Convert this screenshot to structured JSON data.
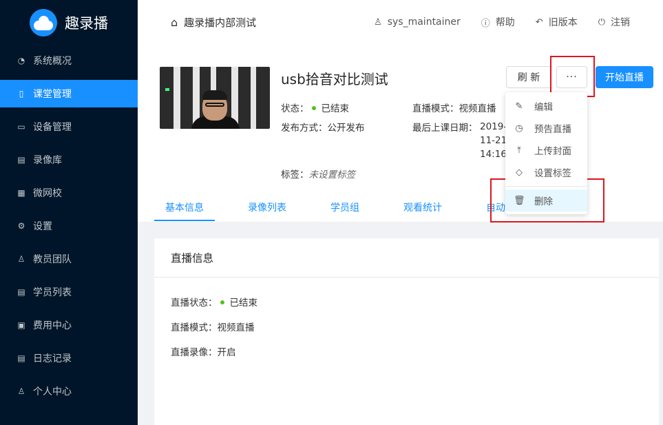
{
  "app": {
    "name": "趣录播"
  },
  "sidebar": {
    "items": [
      {
        "label": "系统概况",
        "icon": "dashboard-icon"
      },
      {
        "label": "课堂管理",
        "icon": "book-icon",
        "active": true
      },
      {
        "label": "设备管理",
        "icon": "camera-icon"
      },
      {
        "label": "录像库",
        "icon": "library-icon"
      },
      {
        "label": "微网校",
        "icon": "school-icon"
      },
      {
        "label": "设置",
        "icon": "gear-icon"
      },
      {
        "label": "教员团队",
        "icon": "team-icon"
      },
      {
        "label": "学员列表",
        "icon": "student-list-icon"
      },
      {
        "label": "费用中心",
        "icon": "billing-icon"
      },
      {
        "label": "日志记录",
        "icon": "log-icon"
      },
      {
        "label": "个人中心",
        "icon": "user-icon"
      }
    ]
  },
  "header": {
    "breadcrumb": "趣录播内部测试",
    "user": "sys_maintainer",
    "help": "帮助",
    "old_version": "旧版本",
    "logout": "注销"
  },
  "course": {
    "title": "usb拾音对比测试",
    "status_label": "状态：",
    "status_value": "已结束",
    "publish_label": "发布方式：",
    "publish_value": "公开发布",
    "mode_label": "直播模式：",
    "mode_value": "视频直播",
    "last_date_label": "最后上课日期：",
    "last_date_lines": [
      "2019-",
      "11-21",
      "14:16"
    ],
    "tags_label": "标签：",
    "tags_value": "未设置标签",
    "refresh_button": "刷 新",
    "more_button": "···",
    "start_button": "开始直播"
  },
  "dropdown": {
    "items": [
      {
        "label": "编辑",
        "icon": "edit-icon"
      },
      {
        "label": "预告直播",
        "icon": "clock-icon"
      },
      {
        "label": "上传封面",
        "icon": "upload-icon"
      },
      {
        "label": "设置标签",
        "icon": "tag-icon"
      }
    ],
    "delete": {
      "label": "删除",
      "icon": "trash-icon"
    }
  },
  "tabs": [
    {
      "label": "基本信息",
      "active": true
    },
    {
      "label": "录像列表"
    },
    {
      "label": "学员组"
    },
    {
      "label": "观看统计"
    },
    {
      "label": "自动"
    }
  ],
  "info": {
    "heading": "直播信息",
    "rows": [
      {
        "label": "直播状态：",
        "value": "已结束"
      },
      {
        "label": "直播模式：",
        "value": "视频直播"
      },
      {
        "label": "直播录像：",
        "value": "开启"
      }
    ]
  },
  "colors": {
    "sidebar_bg": "#001529",
    "accent": "#1890ff",
    "status_green": "#52c41a",
    "highlight_red": "#e0141e"
  }
}
